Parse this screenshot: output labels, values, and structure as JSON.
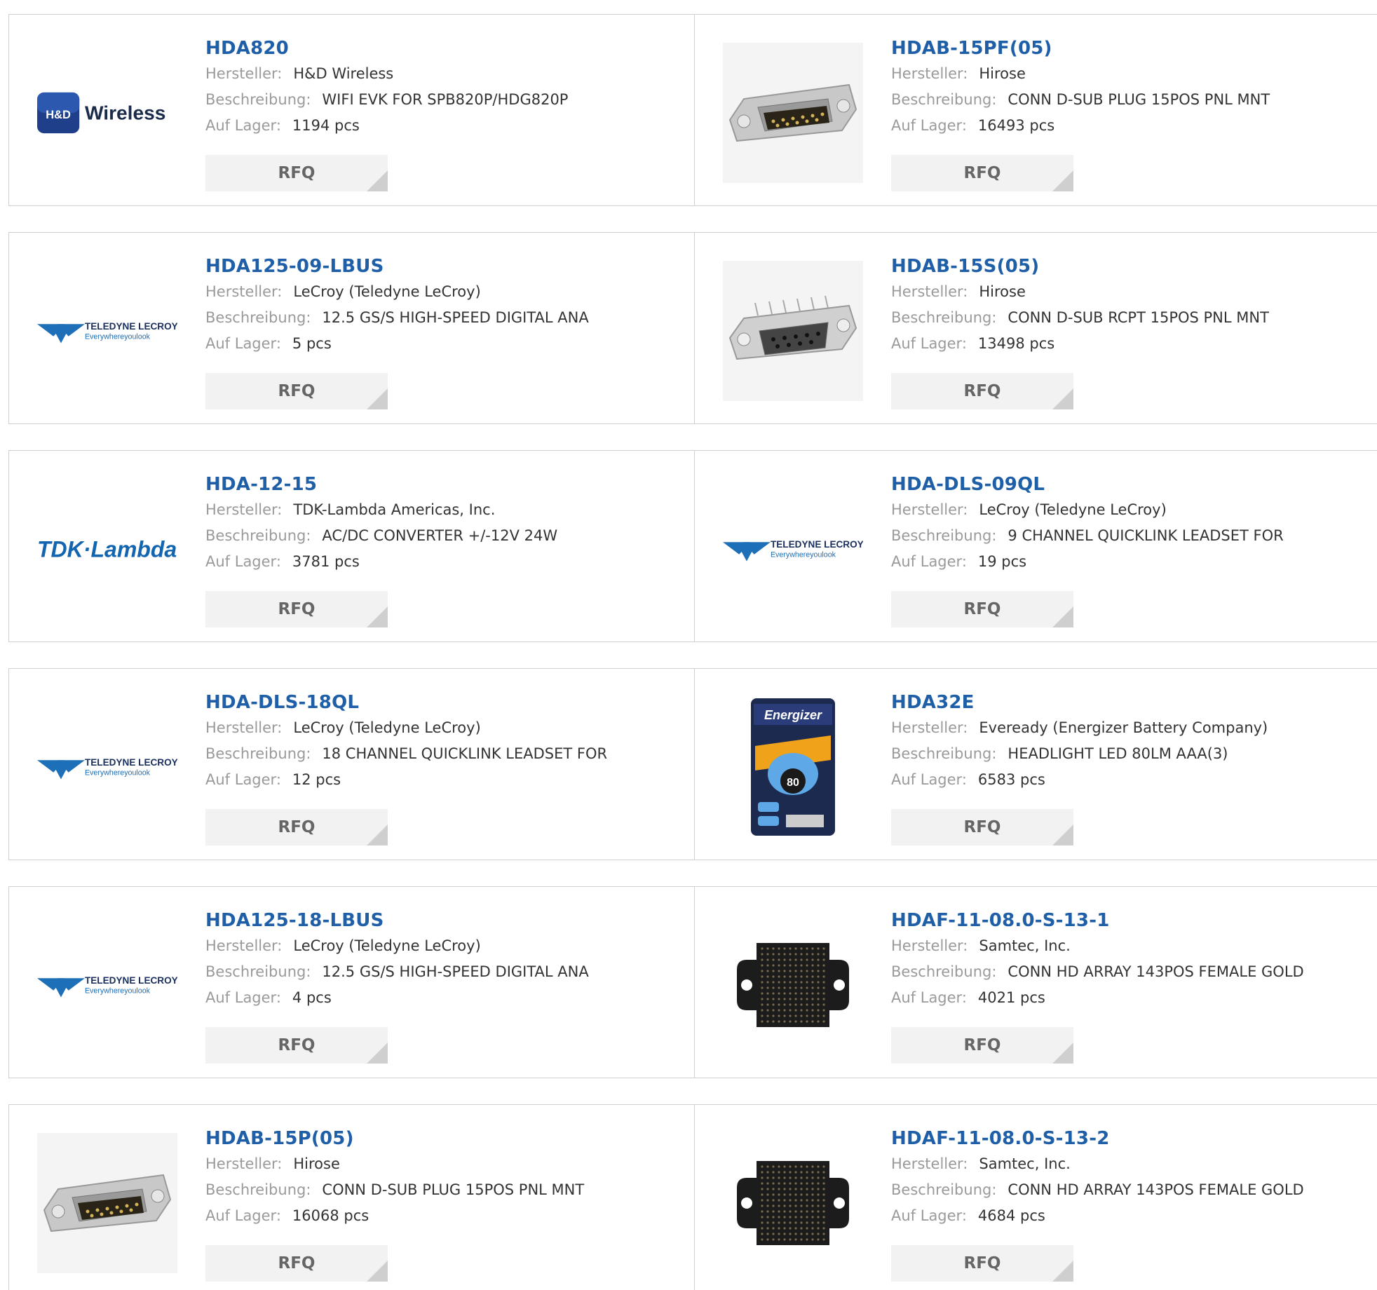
{
  "labels": {
    "manufacturer": "Hersteller:",
    "description": "Beschreibung:",
    "stock": "Auf Lager:",
    "rfq": "RFQ"
  },
  "rows": [
    [
      {
        "part": "HDA820",
        "manufacturer": "H&D Wireless",
        "description": "WIFI EVK FOR SPB820P/HDG820P",
        "stock": "1194 pcs",
        "logo": "hd-wireless-logo",
        "logo_text": [
          "H&D",
          "Wireless"
        ]
      },
      {
        "part": "HDAB-15PF(05)",
        "manufacturer": "Hirose",
        "description": "CONN D-SUB PLUG 15POS PNL MNT",
        "stock": "16493 pcs",
        "logo": "dsub-plug-image"
      }
    ],
    [
      {
        "part": "HDA125-09-LBUS",
        "manufacturer": "LeCroy (Teledyne LeCroy)",
        "description": "12.5 GS/S HIGH-SPEED DIGITAL ANA",
        "stock": "5 pcs",
        "logo": "teledyne-lecroy-logo"
      },
      {
        "part": "HDAB-15S(05)",
        "manufacturer": "Hirose",
        "description": "CONN D-SUB RCPT 15POS PNL MNT",
        "stock": "13498 pcs",
        "logo": "dsub-receptacle-image"
      }
    ],
    [
      {
        "part": "HDA-12-15",
        "manufacturer": "TDK-Lambda Americas, Inc.",
        "description": "AC/DC CONVERTER +/-12V 24W",
        "stock": "3781 pcs",
        "logo": "tdk-lambda-logo",
        "logo_text": [
          "TDK·Lambda"
        ]
      },
      {
        "part": "HDA-DLS-09QL",
        "manufacturer": "LeCroy (Teledyne LeCroy)",
        "description": "9 CHANNEL QUICKLINK LEADSET FOR",
        "stock": "19 pcs",
        "logo": "teledyne-lecroy-logo"
      }
    ],
    [
      {
        "part": "HDA-DLS-18QL",
        "manufacturer": "LeCroy (Teledyne LeCroy)",
        "description": "18 CHANNEL QUICKLINK LEADSET FOR",
        "stock": "12 pcs",
        "logo": "teledyne-lecroy-logo"
      },
      {
        "part": "HDA32E",
        "manufacturer": "Eveready (Energizer Battery Company)",
        "description": "HEADLIGHT LED 80LM AAA(3)",
        "stock": "6583 pcs",
        "logo": "energizer-headlight-image",
        "logo_text": [
          "Energizer",
          "80"
        ]
      }
    ],
    [
      {
        "part": "HDA125-18-LBUS",
        "manufacturer": "LeCroy (Teledyne LeCroy)",
        "description": "12.5 GS/S HIGH-SPEED DIGITAL ANA",
        "stock": "4 pcs",
        "logo": "teledyne-lecroy-logo"
      },
      {
        "part": "HDAF-11-08.0-S-13-1",
        "manufacturer": "Samtec, Inc.",
        "description": "CONN HD ARRAY 143POS FEMALE GOLD",
        "stock": "4021 pcs",
        "logo": "hd-array-connector-image"
      }
    ],
    [
      {
        "part": "HDAB-15P(05)",
        "manufacturer": "Hirose",
        "description": "CONN D-SUB PLUG 15POS PNL MNT",
        "stock": "16068 pcs",
        "logo": "dsub-plug-image"
      },
      {
        "part": "HDAF-11-08.0-S-13-2",
        "manufacturer": "Samtec, Inc.",
        "description": "CONN HD ARRAY 143POS FEMALE GOLD",
        "stock": "4684 pcs",
        "logo": "hd-array-connector-image"
      }
    ]
  ],
  "teledyne_logo_text": [
    "TELEDYNE LECROY",
    "Everywhereyoulook"
  ],
  "colors": {
    "part_link": "#1e5fa8",
    "label": "#9a9a9a",
    "value": "#333333",
    "rfq_bg": "#f2f2f2",
    "border": "#d0d0d0"
  }
}
